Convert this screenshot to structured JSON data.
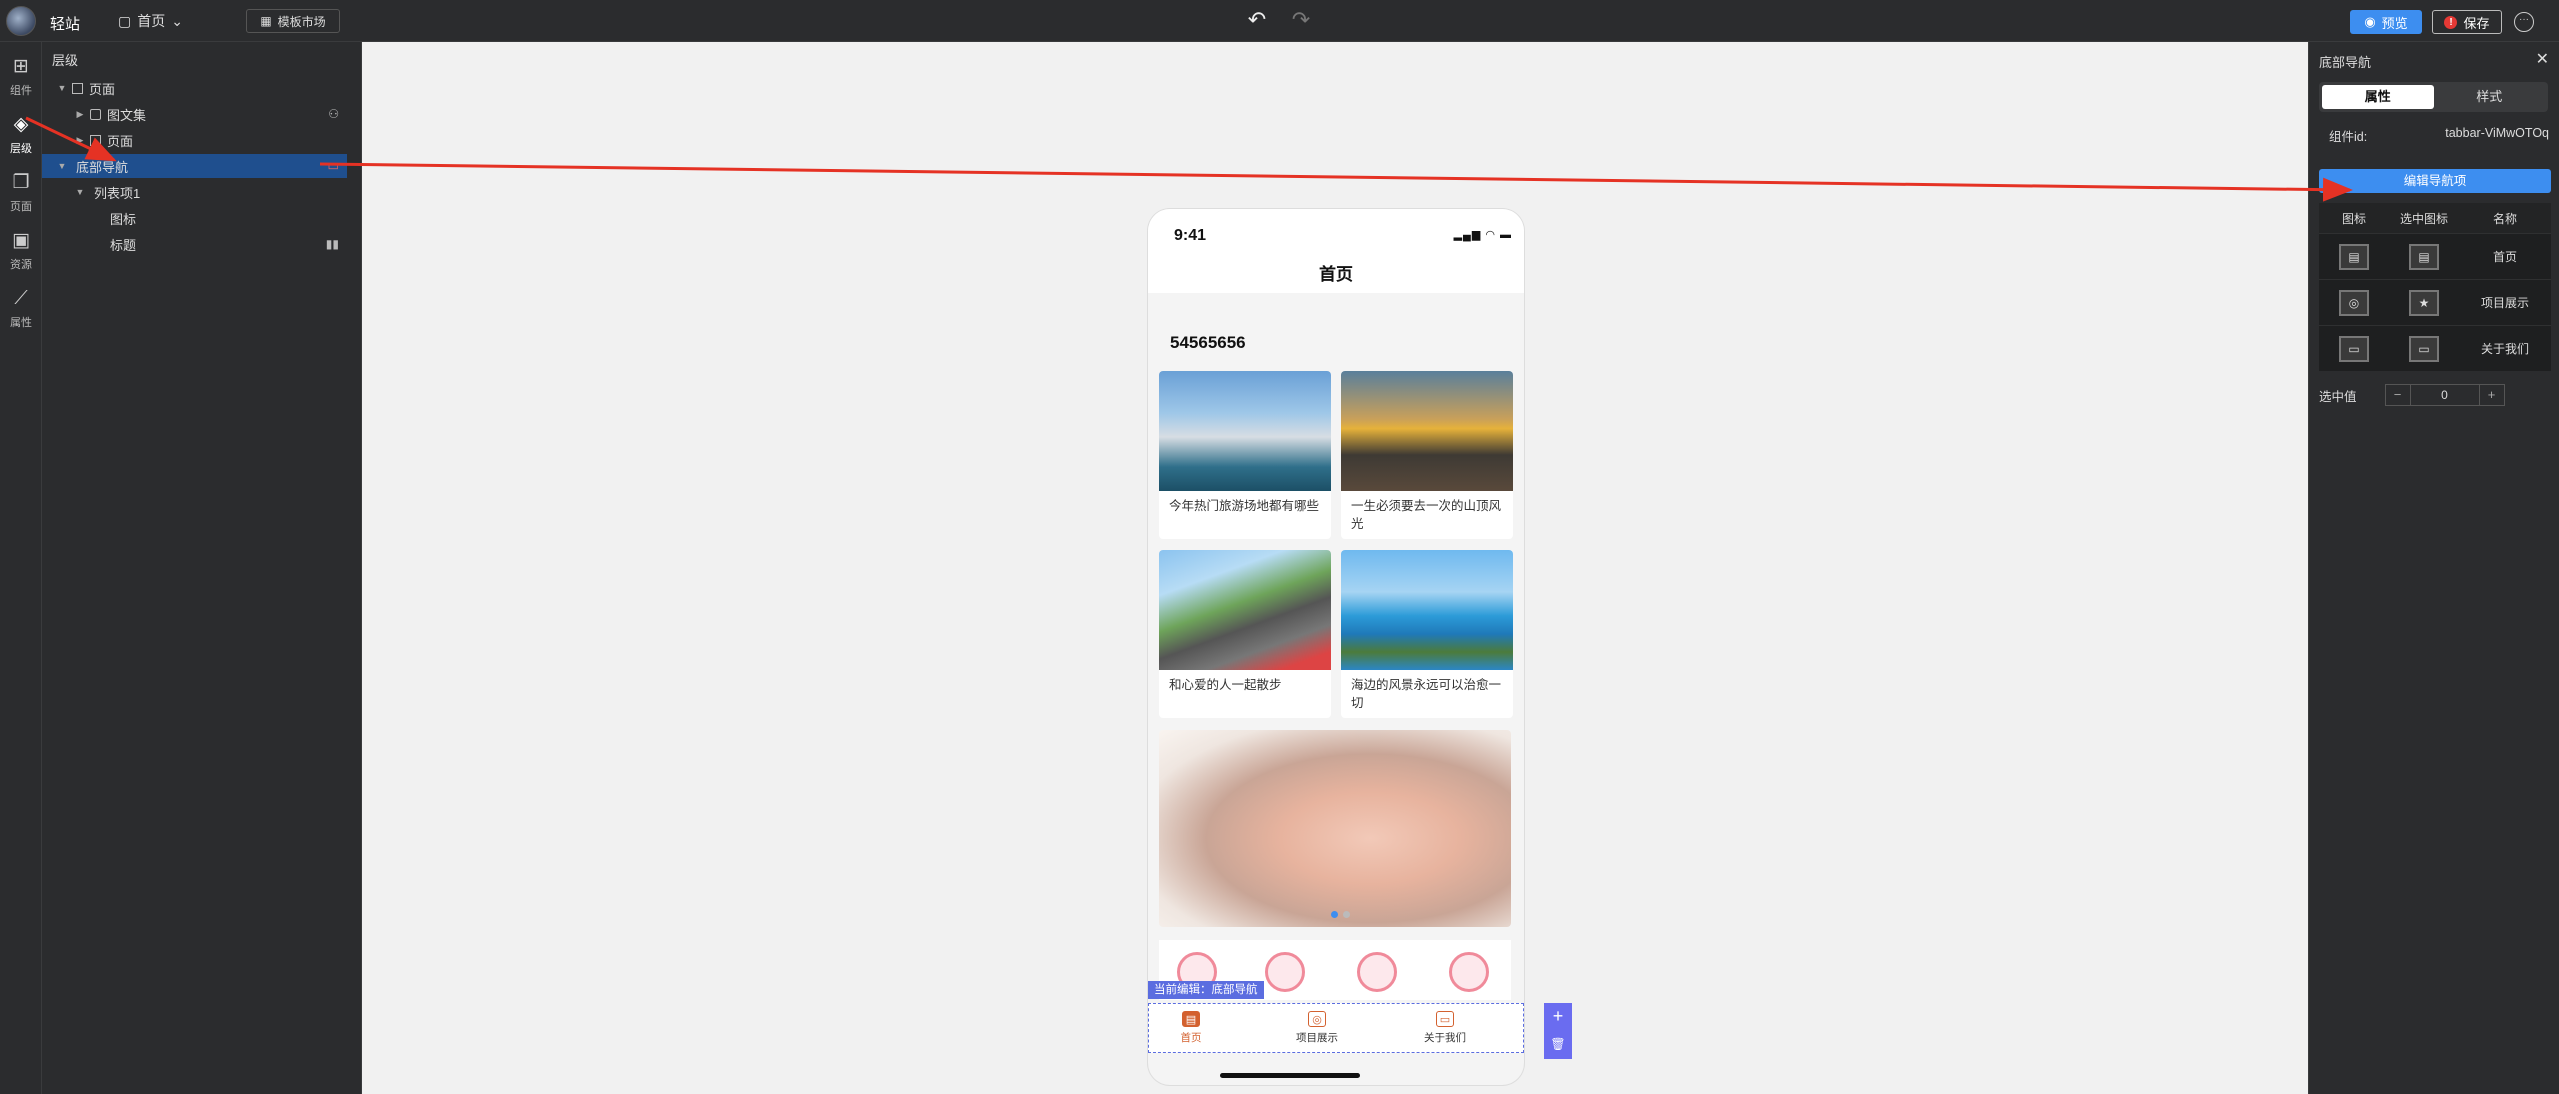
{
  "topbar": {
    "brand": "轻站",
    "page_select": "首页",
    "template_market": "模板市场",
    "preview": "预览",
    "save": "保存",
    "save_badge": "!"
  },
  "leftrail": [
    {
      "label": "组件",
      "icon": "grid-icon"
    },
    {
      "label": "层级",
      "icon": "layers-icon"
    },
    {
      "label": "页面",
      "icon": "pages-icon"
    },
    {
      "label": "资源",
      "icon": "image-icon"
    },
    {
      "label": "属性",
      "icon": "wand-icon"
    }
  ],
  "layers": {
    "title": "层级",
    "items": [
      {
        "label": "页面"
      },
      {
        "label": "图文集"
      },
      {
        "label": "页面"
      },
      {
        "label": "底部导航"
      },
      {
        "label": "列表项1"
      },
      {
        "label": "图标"
      },
      {
        "label": "标题"
      }
    ]
  },
  "phone": {
    "time": "9:41",
    "title": "首页",
    "number_title": "54565656",
    "cards": [
      {
        "caption": "今年热门旅游场地都有哪些"
      },
      {
        "caption": "一生必须要去一次的山顶风光"
      },
      {
        "caption": "和心爱的人一起散步"
      },
      {
        "caption": "海边的风景永远可以治愈一切"
      }
    ],
    "banner_dots": 2,
    "editing_tag": "当前编辑：底部导航",
    "tabs": [
      {
        "label": "首页",
        "active": true
      },
      {
        "label": "项目展示",
        "active": false
      },
      {
        "label": "关于我们",
        "active": false
      }
    ]
  },
  "rightpanel": {
    "title": "底部导航",
    "tab_props": "属性",
    "tab_style": "样式",
    "component_id_label": "组件id:",
    "component_id_value": "tabbar-ViMwOTOq",
    "edit_nav_button": "编辑导航项",
    "table_headers": [
      "图标",
      "选中图标",
      "名称"
    ],
    "table_rows": [
      {
        "name": "首页"
      },
      {
        "name": "项目展示"
      },
      {
        "name": "关于我们"
      }
    ],
    "selected_label": "选中值",
    "selected_value": "0"
  },
  "colors": {
    "accent": "#3d8ef0",
    "tab_active": "#d3612f",
    "edit_outline": "#5b6de0",
    "arrow": "#e53224"
  }
}
